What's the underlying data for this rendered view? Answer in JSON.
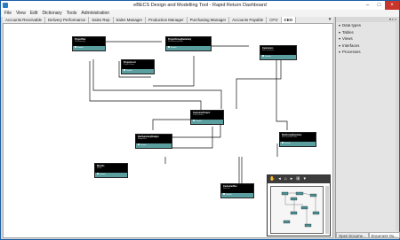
{
  "window": {
    "title": "eBECS Design and Modelling Tool - Rapid Return Dashboard"
  },
  "menu": [
    "File",
    "View",
    "Edit",
    "Dictionary",
    "Tools",
    "Administration"
  ],
  "tabs": [
    {
      "label": "Accounts Receivable",
      "active": false
    },
    {
      "label": "Delivery Performance",
      "active": false
    },
    {
      "label": "Sales Rep",
      "active": false
    },
    {
      "label": "Sales Manager",
      "active": false
    },
    {
      "label": "Production Manager",
      "active": false
    },
    {
      "label": "Purchasing Manager",
      "active": false
    },
    {
      "label": "Accounts Payable",
      "active": false
    },
    {
      "label": "CFO",
      "active": false
    },
    {
      "label": "CEO",
      "active": true
    }
  ],
  "nodes": [
    {
      "title": "ProjectRev",
      "sub": "RevSummary",
      "foot": "Details"
    },
    {
      "title": "ProjectGroupSummary",
      "sub": "RevSummaryTable",
      "foot": "Details"
    },
    {
      "title": "Customers",
      "sub": "RevCustomers",
      "foot": "Details"
    },
    {
      "title": "ProjectsList",
      "sub": "ProjectGroup",
      "foot": "Details"
    },
    {
      "title": "CustomerProject",
      "sub": "ProjCustomer",
      "foot": "Details"
    },
    {
      "title": "RevSummaryBudget",
      "sub": "BudgetRev",
      "foot": "Details"
    },
    {
      "title": "RevGroupSummary",
      "sub": "RevCustomerTable",
      "foot": "Details"
    },
    {
      "title": "Months",
      "sub": "Month",
      "foot": "Details"
    },
    {
      "title": "CustomerRev",
      "sub": "RevCust",
      "foot": "Details"
    }
  ],
  "overview": {
    "buttons": [
      "hand-icon",
      "zoom-out-icon",
      "home-icon",
      "zoom-in-icon",
      "fit-icon",
      "menu-icon"
    ]
  },
  "sidepanel": {
    "header": "▾ ▪ ×",
    "items": [
      "Data types",
      "Tables",
      "Views",
      "Interfaces",
      "Processes"
    ],
    "tabs": [
      {
        "label": "Open Docume...",
        "active": false
      },
      {
        "label": "Document Ou...",
        "active": true
      }
    ]
  },
  "colors": {
    "node_head": "#000000",
    "node_foot": "#5a9ea0",
    "frame": "#1b5fa8",
    "close": "#c7352b"
  }
}
